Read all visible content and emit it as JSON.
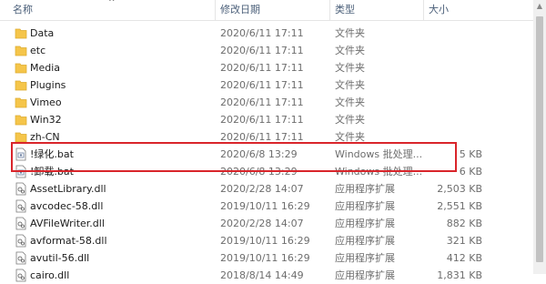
{
  "header": {
    "name": "名称",
    "date": "修改日期",
    "type": "类型",
    "size": "大小",
    "sort_indicator": "^"
  },
  "rows": [
    {
      "name": "Data",
      "date": "2020/6/11 17:11",
      "type": "文件夹",
      "size": "",
      "icon": "folder-icon"
    },
    {
      "name": "etc",
      "date": "2020/6/11 17:11",
      "type": "文件夹",
      "size": "",
      "icon": "folder-icon"
    },
    {
      "name": "Media",
      "date": "2020/6/11 17:11",
      "type": "文件夹",
      "size": "",
      "icon": "folder-icon"
    },
    {
      "name": "Plugins",
      "date": "2020/6/11 17:11",
      "type": "文件夹",
      "size": "",
      "icon": "folder-icon"
    },
    {
      "name": "Vimeo",
      "date": "2020/6/11 17:11",
      "type": "文件夹",
      "size": "",
      "icon": "folder-icon"
    },
    {
      "name": "Win32",
      "date": "2020/6/11 17:11",
      "type": "文件夹",
      "size": "",
      "icon": "folder-icon"
    },
    {
      "name": "zh-CN",
      "date": "2020/6/11 17:11",
      "type": "文件夹",
      "size": "",
      "icon": "folder-icon"
    },
    {
      "name": "!绿化.bat",
      "date": "2020/6/8 13:29",
      "type": "Windows 批处理...",
      "size": "5 KB",
      "icon": "batch-file-icon"
    },
    {
      "name": "!卸载.bat",
      "date": "2020/6/8 13:29",
      "type": "Windows 批处理...",
      "size": "6 KB",
      "icon": "batch-file-icon"
    },
    {
      "name": "AssetLibrary.dll",
      "date": "2020/2/28 14:07",
      "type": "应用程序扩展",
      "size": "2,503 KB",
      "icon": "dll-file-icon"
    },
    {
      "name": "avcodec-58.dll",
      "date": "2019/10/11 16:29",
      "type": "应用程序扩展",
      "size": "2,551 KB",
      "icon": "dll-file-icon"
    },
    {
      "name": "AVFileWriter.dll",
      "date": "2020/2/28 14:07",
      "type": "应用程序扩展",
      "size": "882 KB",
      "icon": "dll-file-icon"
    },
    {
      "name": "avformat-58.dll",
      "date": "2019/10/11 16:29",
      "type": "应用程序扩展",
      "size": "321 KB",
      "icon": "dll-file-icon"
    },
    {
      "name": "avutil-56.dll",
      "date": "2019/10/11 16:29",
      "type": "应用程序扩展",
      "size": "412 KB",
      "icon": "dll-file-icon"
    },
    {
      "name": "cairo.dll",
      "date": "2018/8/14 14:49",
      "type": "应用程序扩展",
      "size": "1,831 KB",
      "icon": "dll-file-icon"
    }
  ],
  "colors": {
    "folder": "#f5c54a",
    "highlight_border": "#d9252b",
    "header_text": "#4c607a"
  }
}
